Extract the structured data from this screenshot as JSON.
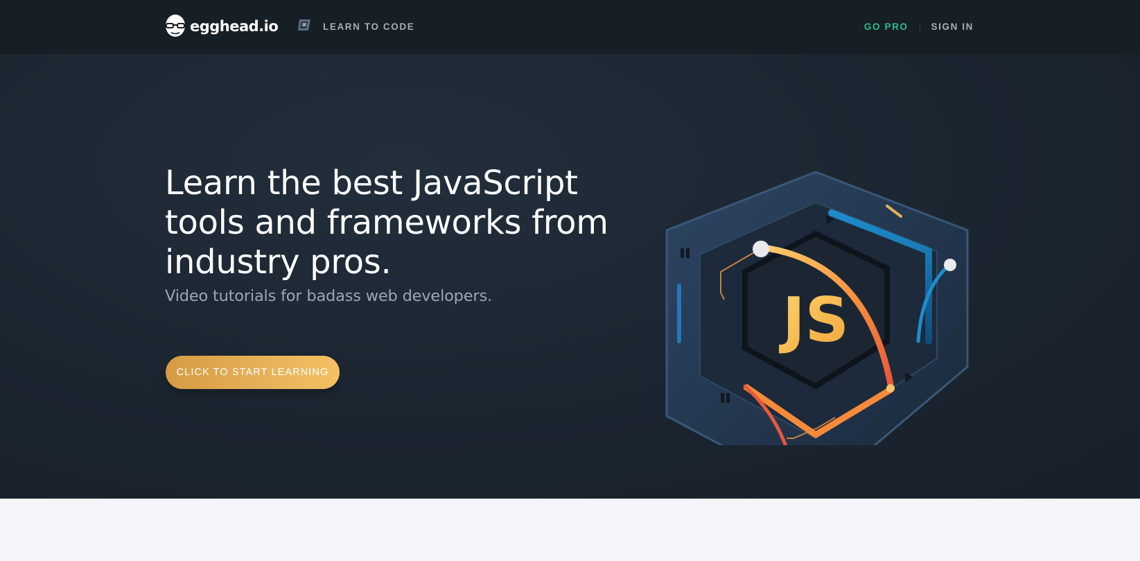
{
  "colors": {
    "nav_bg": "#161e26",
    "hero_bg": "#1b2530",
    "accent_green": "#2fc08a",
    "cta_gold": "#e9b25a",
    "page_bg": "#f4f5f9"
  },
  "navbar": {
    "logo_icon": "egghead-mascot-icon",
    "logo_text": "egghead.io",
    "learn_icon": "book-icon",
    "learn_label": "LEARN TO CODE",
    "go_pro_label": "GO PRO",
    "sign_in_label": "SIGN IN"
  },
  "hero": {
    "headline": "Learn the best JavaScript tools and frameworks from industry pros.",
    "subheadline": "Video tutorials for badass web developers.",
    "cta_label": "CLICK TO START LEARNING",
    "illustration_icon": "javascript-hexagon-badge-icon",
    "badge_text": "JS"
  }
}
